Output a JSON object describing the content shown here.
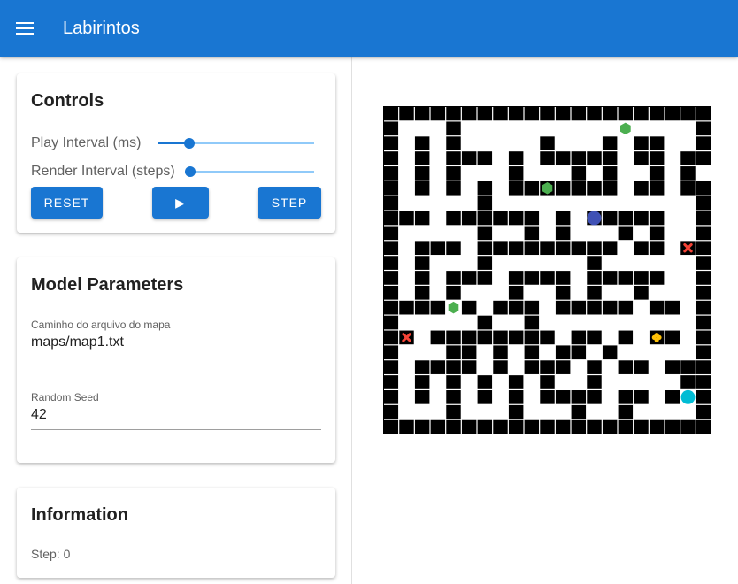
{
  "app": {
    "title": "Labirintos",
    "menu_icon": "menu-icon"
  },
  "controls": {
    "title": "Controls",
    "play_interval": {
      "label": "Play Interval (ms)",
      "value": 0.2
    },
    "render_interval": {
      "label": "Render Interval (steps)",
      "value": 0.0
    },
    "reset_label": "RESET",
    "play_label": "▶",
    "step_label": "STEP"
  },
  "model_parameters": {
    "title": "Model Parameters",
    "map_path": {
      "label": "Caminho do arquivo do mapa",
      "value": "maps/map1.txt"
    },
    "seed": {
      "label": "Random Seed",
      "value": "42"
    }
  },
  "information": {
    "title": "Information",
    "step_text": "Step: 0"
  },
  "maze": {
    "wall_color": "#000000",
    "grid": [
      "#####################",
      "#...#...............#",
      "#.#.#.....#...#.##..#",
      "#.#.###.#.#####.##.##",
      "#.#.#...#...#.#..#.#",
      "#.#.#.#.#######.##.##",
      "#.....#.............#",
      "###.######.#.#####..#",
      "#.....#..#.#...#.#..#",
      "#.###.#########.##.##",
      "#.#...#......#......#",
      "#.#.###.####.#####..#",
      "#.#.#...#..#.#..#...#",
      "####.#.###.#####.##.#",
      "#.....#..#..........#",
      "##.########.##.#.##.#",
      "#...##.#.#.##.#.....#",
      "#.####.#.###.#.##.###",
      "#.#.#.#.#.#..#.....##",
      "#.#.#.#.#.####.##.#.#",
      "#...#...#...#..#....#",
      "#####################"
    ],
    "agents": [
      {
        "type": "hexagon",
        "color": "#4caf50",
        "row": 1.5,
        "col": 15.5
      },
      {
        "type": "hexagon",
        "color": "#4caf50",
        "row": 5.5,
        "col": 10.5
      },
      {
        "type": "circle",
        "color": "#3f51b5",
        "row": 7.5,
        "col": 13.5
      },
      {
        "type": "cross",
        "color": "#f44336",
        "row": 9.5,
        "col": 19.5
      },
      {
        "type": "hexagon",
        "color": "#4caf50",
        "row": 13.5,
        "col": 4.5
      },
      {
        "type": "cross",
        "color": "#f44336",
        "row": 15.5,
        "col": 1.5
      },
      {
        "type": "plus",
        "color": "#ffc107",
        "row": 15.5,
        "col": 17.5
      },
      {
        "type": "circle",
        "color": "#00bcd4",
        "row": 19.5,
        "col": 19.5
      }
    ]
  }
}
